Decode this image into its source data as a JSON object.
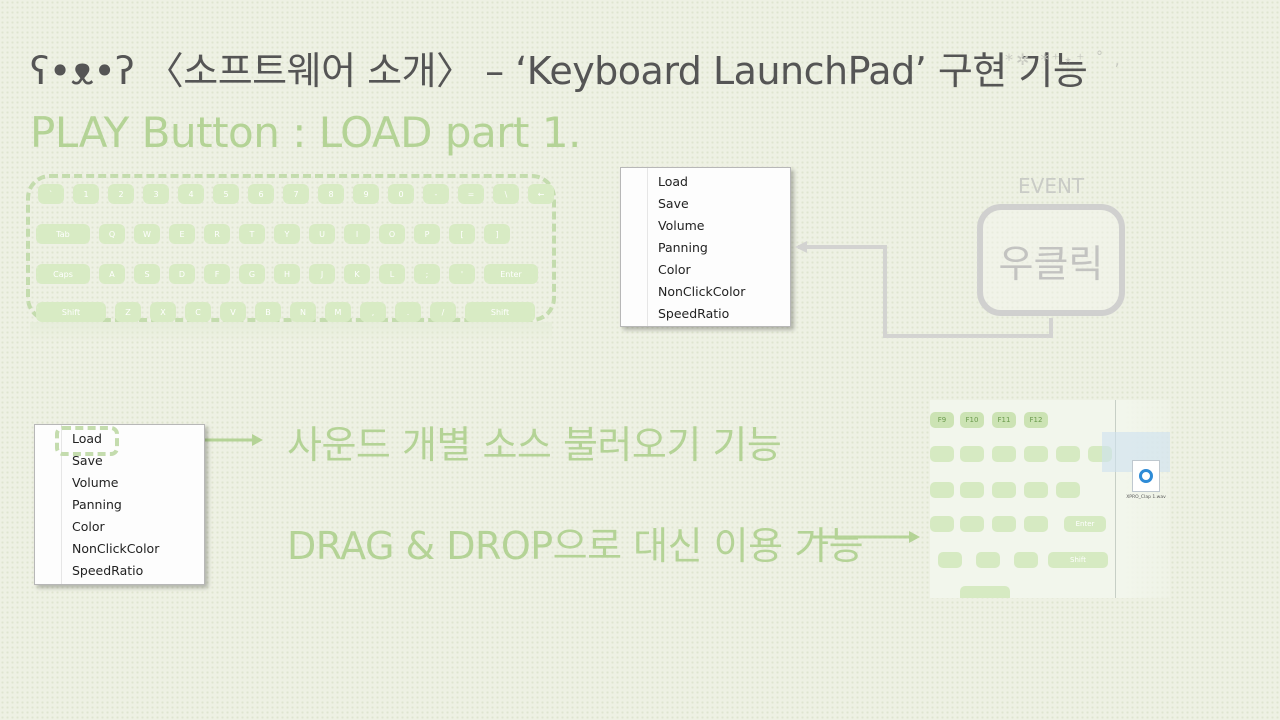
{
  "title": "ʕ•ᴥ•ʔ 〈소프트웨어 소개〉 – ‘Keyboard LaunchPad’ 구현 기능",
  "subtitle": "PLAY Button : LOAD part 1.",
  "keyboard": {
    "rows": [
      [
        "`",
        "1",
        "2",
        "3",
        "4",
        "5",
        "6",
        "7",
        "8",
        "9",
        "0",
        "-",
        "=",
        "\\",
        "←"
      ],
      [
        "Tab",
        "Q",
        "W",
        "E",
        "R",
        "T",
        "Y",
        "U",
        "I",
        "O",
        "P",
        "[",
        "]"
      ],
      [
        "Caps",
        "A",
        "S",
        "D",
        "F",
        "G",
        "H",
        "J",
        "K",
        "L",
        ";",
        "'",
        "Enter"
      ],
      [
        "Shift",
        "Z",
        "X",
        "C",
        "V",
        "B",
        "N",
        "M",
        ",",
        ".",
        "/",
        "Shift"
      ]
    ]
  },
  "context_menu": {
    "items": [
      "Load",
      "Save",
      "Volume",
      "Panning",
      "Color",
      "NonClickColor",
      "SpeedRatio"
    ]
  },
  "event": {
    "label": "EVENT",
    "action": "우클릭"
  },
  "descriptions": {
    "load_feature": "사운드 개별 소스 불러오기 기능",
    "drag_drop": "DRAG & DROP으로 대신 이용 가능"
  },
  "screenshot": {
    "function_keys": [
      "F9",
      "F10",
      "F11",
      "F12"
    ],
    "enter_label": "Enter",
    "shift_label": "Shift",
    "file_name": "XPRO_Clap 1.wav"
  },
  "colors": {
    "accent_green": "#b4d396",
    "key_green": "#d8ebc4",
    "title_gray": "#555555"
  }
}
